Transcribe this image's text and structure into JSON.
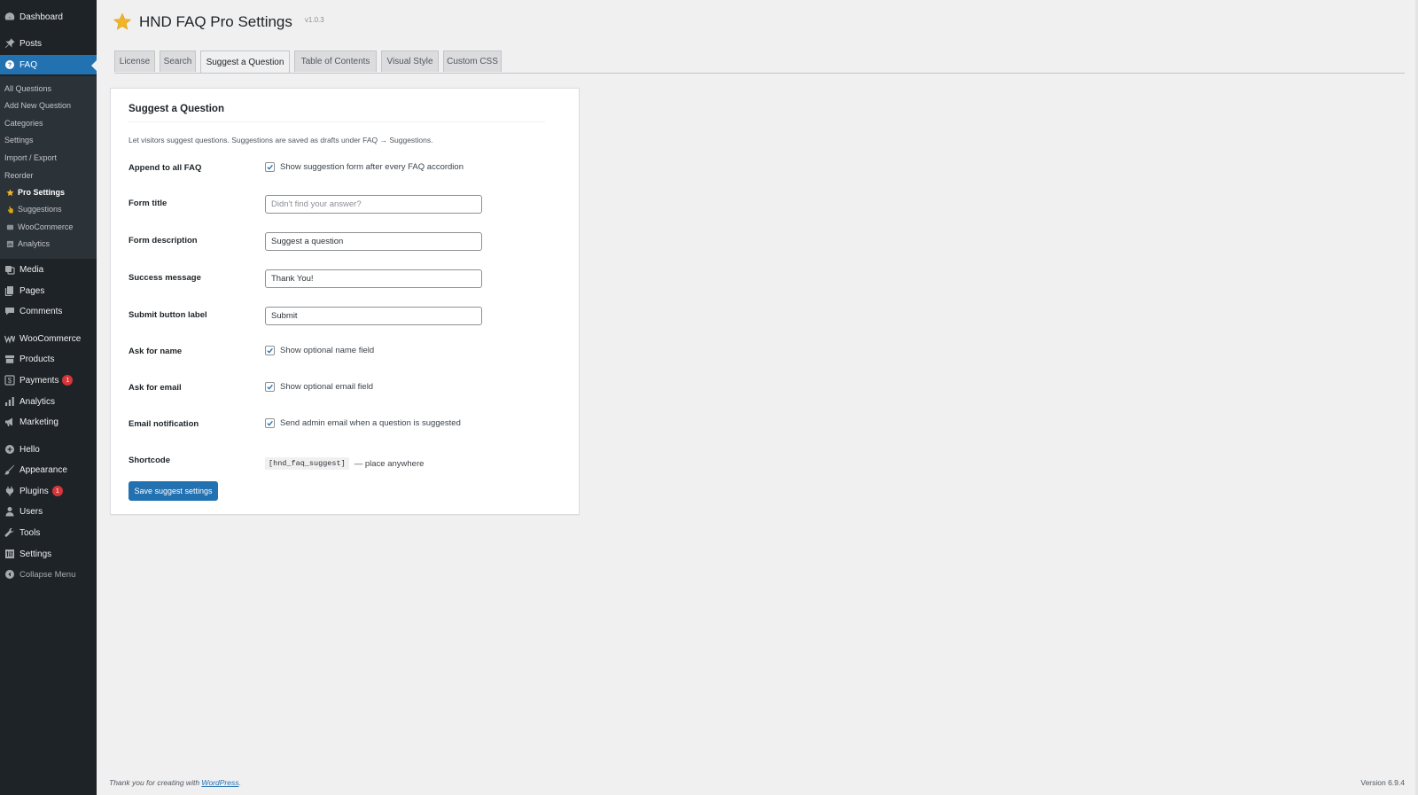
{
  "sidebar": {
    "top": [
      {
        "label": "Dashboard",
        "icon": "dashboard-icon"
      },
      {
        "label": "Posts",
        "icon": "pin-icon"
      },
      {
        "label": "FAQ",
        "icon": "help-circle-icon",
        "active": true
      }
    ],
    "faq_submenu": [
      {
        "label": "All Questions"
      },
      {
        "label": "Add New Question"
      },
      {
        "label": "Categories"
      },
      {
        "label": "Settings"
      },
      {
        "label": "Import / Export"
      },
      {
        "label": "Reorder"
      },
      {
        "label": "Pro Settings",
        "icon": "star-icon",
        "current": true
      },
      {
        "label": "Suggestions",
        "icon": "hand-icon"
      },
      {
        "label": "WooCommerce",
        "icon": "store-icon"
      },
      {
        "label": "Analytics",
        "icon": "chart-icon"
      }
    ],
    "bottom": [
      {
        "label": "Media",
        "icon": "media-icon"
      },
      {
        "label": "Pages",
        "icon": "pages-icon"
      },
      {
        "label": "Comments",
        "icon": "comment-icon"
      },
      {
        "label": "WooCommerce",
        "icon": "woo-icon"
      },
      {
        "label": "Products",
        "icon": "archive-icon"
      },
      {
        "label": "Payments",
        "icon": "dollar-icon",
        "badge": "1"
      },
      {
        "label": "Analytics",
        "icon": "bar-chart-icon"
      },
      {
        "label": "Marketing",
        "icon": "megaphone-icon"
      },
      {
        "label": "Hello",
        "icon": "plus-circle-icon"
      },
      {
        "label": "Appearance",
        "icon": "brush-icon"
      },
      {
        "label": "Plugins",
        "icon": "plugin-icon",
        "badge": "1"
      },
      {
        "label": "Users",
        "icon": "user-icon"
      },
      {
        "label": "Tools",
        "icon": "wrench-icon"
      },
      {
        "label": "Settings",
        "icon": "settings-icon"
      }
    ],
    "collapse_label": "Collapse Menu"
  },
  "header": {
    "title": "HND FAQ Pro Settings",
    "version": "v1.0.3"
  },
  "tabs": [
    {
      "label": "License"
    },
    {
      "label": "Search"
    },
    {
      "label": "Suggest a Question",
      "active": true
    },
    {
      "label": "Table of Contents"
    },
    {
      "label": "Visual Style"
    },
    {
      "label": "Custom CSS"
    }
  ],
  "card": {
    "title": "Suggest a Question",
    "description": "Let visitors suggest questions. Suggestions are saved as drafts under FAQ → Suggestions.",
    "append": {
      "label": "Append to all FAQ",
      "checkbox_label": "Show suggestion form after every FAQ accordion",
      "checked": true
    },
    "form_title": {
      "label": "Form title",
      "placeholder": "Didn't find your answer?",
      "value": ""
    },
    "form_description": {
      "label": "Form description",
      "value": "Suggest a question"
    },
    "success_message": {
      "label": "Success message",
      "value": "Thank You!"
    },
    "submit_label": {
      "label": "Submit button label",
      "value": "Submit"
    },
    "ask_name": {
      "label": "Ask for name",
      "checkbox_label": "Show optional name field",
      "checked": true
    },
    "ask_email": {
      "label": "Ask for email",
      "checkbox_label": "Show optional email field",
      "checked": true
    },
    "email_notification": {
      "label": "Email notification",
      "checkbox_label": "Send admin email when a question is suggested",
      "checked": true
    },
    "shortcode": {
      "label": "Shortcode",
      "code": "[hnd_faq_suggest]",
      "note": "— place anywhere"
    },
    "save_label": "Save suggest settings"
  },
  "footer": {
    "left_prefix": "Thank you for creating with ",
    "left_link": "WordPress",
    "left_suffix": ".",
    "version": "Version 6.9.4"
  },
  "colors": {
    "sidebar_bg": "#1d2327",
    "submenu_bg": "#2c3338",
    "accent": "#2271b1",
    "badge": "#d63638",
    "page_bg": "#f0f0f1",
    "star": "#f0b429"
  }
}
